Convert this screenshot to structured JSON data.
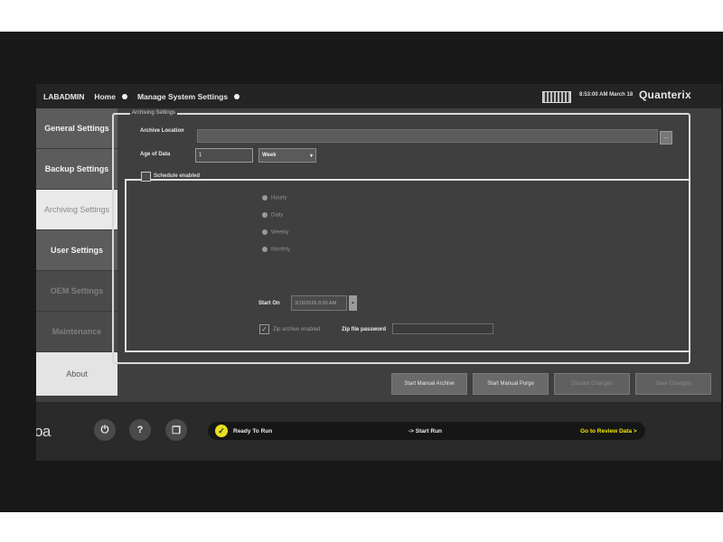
{
  "topbar": {
    "user": "LABADMIN",
    "home": "Home",
    "section": "Manage System Settings",
    "time": "8:53:00 AM",
    "date": "March 18",
    "brand": "Quanterix"
  },
  "sidebar": {
    "items": [
      {
        "label": "General Settings"
      },
      {
        "label": "Backup Settings"
      },
      {
        "label": "Archiving Settings"
      },
      {
        "label": "User Settings"
      },
      {
        "label": "OEM Settings"
      },
      {
        "label": "Maintenance"
      },
      {
        "label": "About"
      }
    ]
  },
  "archiving": {
    "legend": "Archiving Settings",
    "archive_location_label": "Archive Location",
    "archive_location_value": "",
    "browse_label": "...",
    "age_label": "Age of Data",
    "age_value": "1",
    "age_unit": "Week",
    "schedule_label": "Schedule enabled",
    "frequency_options": [
      "Hourly",
      "Daily",
      "Weekly",
      "Monthly"
    ],
    "start_on_label": "Start On",
    "start_on_value": "3/19/2026 8:00 AM",
    "zip_label": "Zip archive enabled",
    "zip_password_label": "Zip file password"
  },
  "actions": {
    "start_archive": "Start Manual Archive",
    "start_purge": "Start Manual Purge",
    "discard": "Discard Changes",
    "save": "Save Changes"
  },
  "bottombar": {
    "logo": "simoa",
    "power_icon": "power-icon",
    "help_label": "?",
    "ready_label": "Ready To Run",
    "start_run_label": "-> Start Run",
    "review_label": "Go to Review Data >"
  }
}
